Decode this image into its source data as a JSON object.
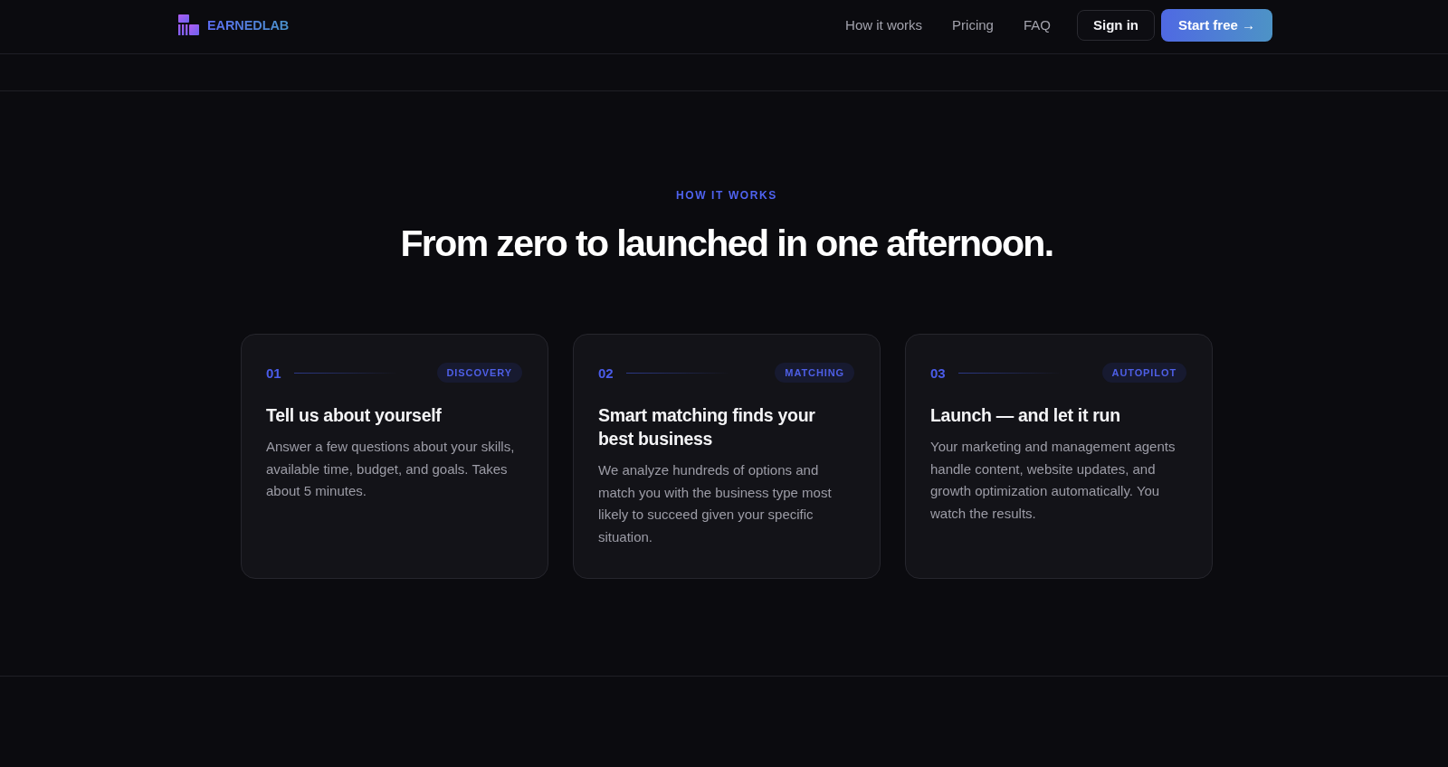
{
  "header": {
    "logo": {
      "text": "EARNEDLAB"
    },
    "nav": [
      {
        "label": "How it works"
      },
      {
        "label": "Pricing"
      },
      {
        "label": "FAQ"
      }
    ],
    "buttons": [
      {
        "label": "Sign in",
        "kind": "outline"
      },
      {
        "label": "Start free →",
        "kind": "gradient"
      }
    ]
  },
  "section": {
    "eyebrow": "HOW IT WORKS",
    "title": "From zero to launched in one afternoon.",
    "steps": [
      {
        "number": "01",
        "tag": "DISCOVERY",
        "title": "Tell us about yourself",
        "body": "Answer a few questions about your skills, available time, budget, and goals. Takes about 5 minutes."
      },
      {
        "number": "02",
        "tag": "MATCHING",
        "title": "Smart matching finds your best business",
        "body": "We analyze hundreds of options and match you with the business type most likely to succeed given your specific situation."
      },
      {
        "number": "03",
        "tag": "AUTOPILOT",
        "title": "Launch — and let it run",
        "body": "Your marketing and management agents handle content, website updates, and growth optimization automatically. You watch the results."
      }
    ]
  }
}
